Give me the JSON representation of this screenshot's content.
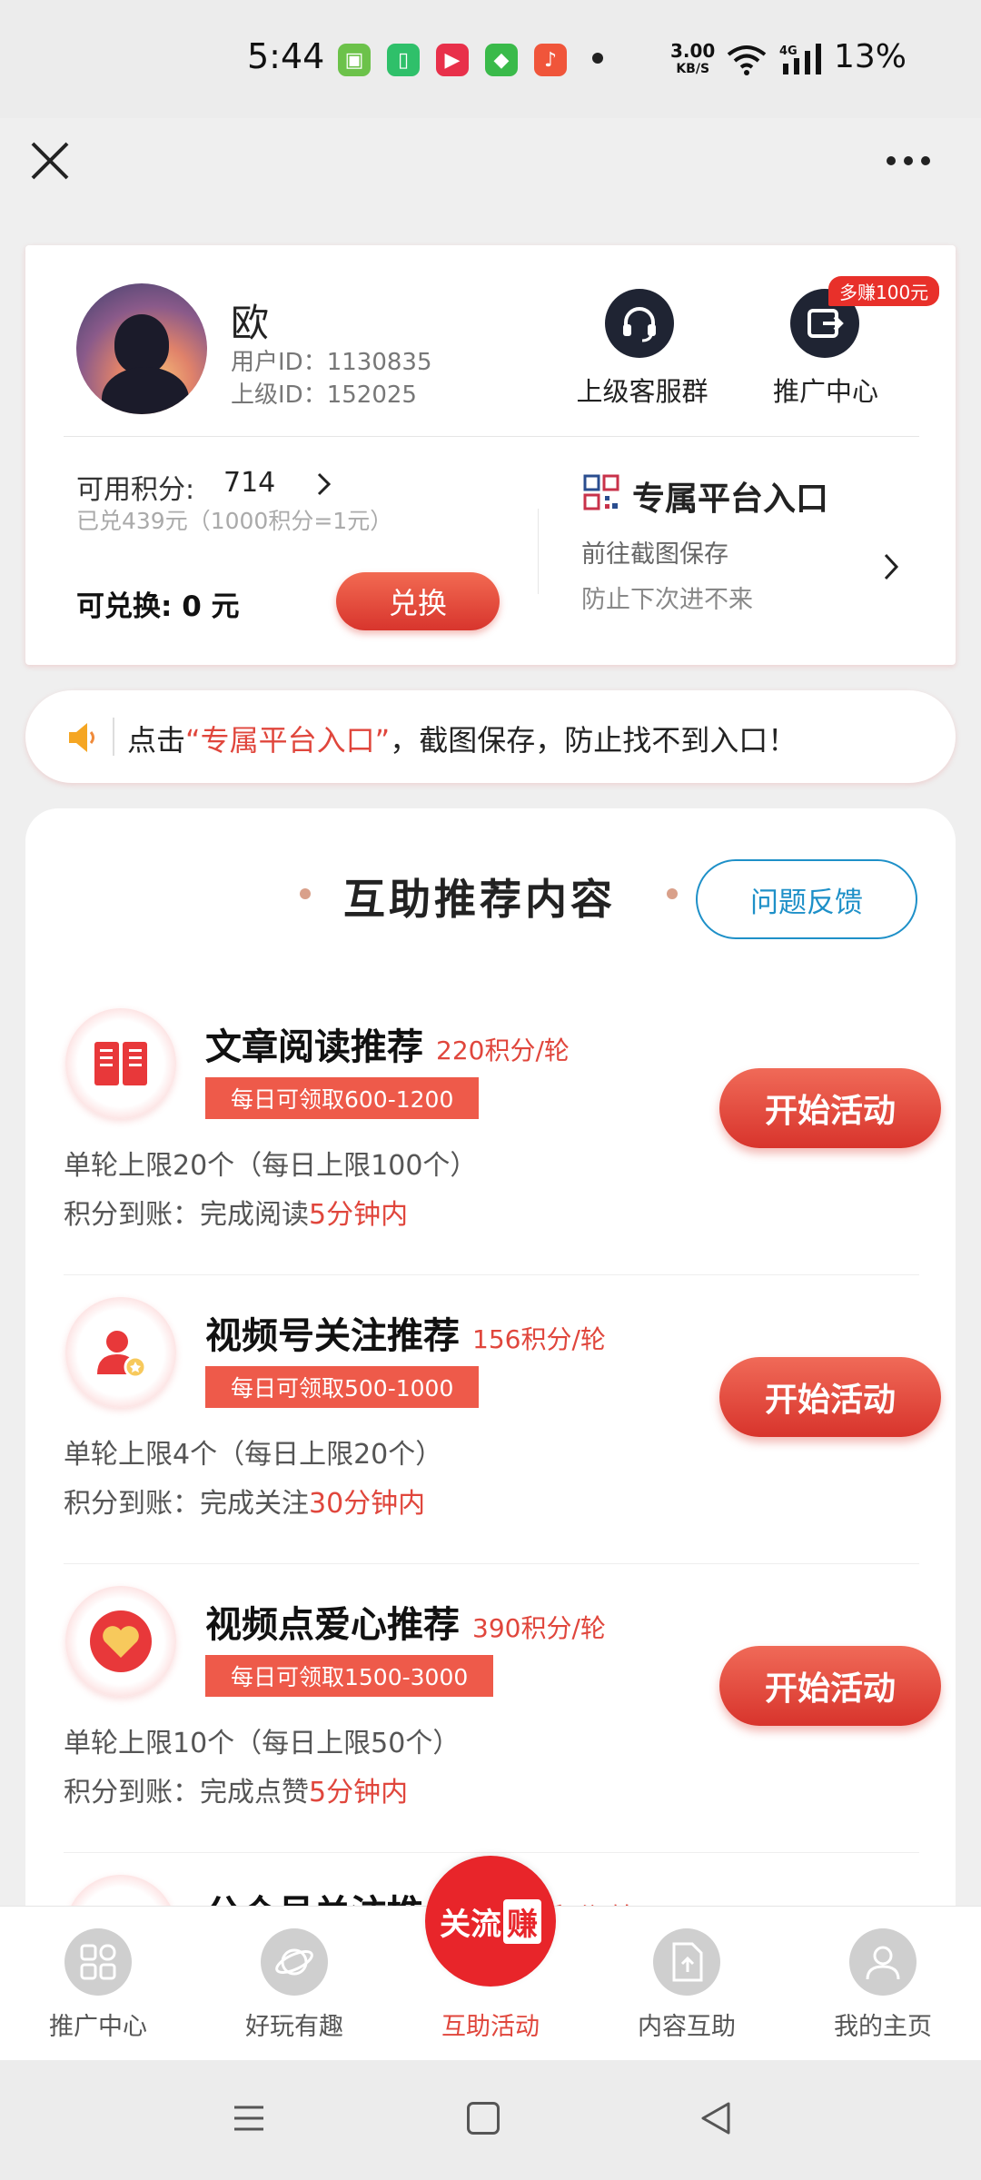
{
  "status_bar": {
    "time": "5:44",
    "net_speed_value": "3.00",
    "net_speed_unit": "KB/S",
    "network": "4G",
    "battery": "13%"
  },
  "profile": {
    "name": "欧",
    "user_id": "用户ID：1130835",
    "parent_id": "上级ID：152025",
    "cs_group_label": "上级客服群",
    "promo_label": "推广中心",
    "earn_badge": "多赚100元"
  },
  "points": {
    "label": "可用积分:",
    "value": "714",
    "redeemed": "已兑439元（1000积分=1元）",
    "exchangeable": "可兑换: 0 元",
    "exchange_button": "兑换"
  },
  "platform": {
    "title": "专属平台入口",
    "sub1": "前往截图保存",
    "sub2": "防止下次进不来"
  },
  "notice": {
    "prefix": "点击",
    "highlight": "“专属平台入口”",
    "suffix": "，截图保存，防止找不到入口！"
  },
  "section": {
    "title": "互助推荐内容",
    "feedback_button": "问题反馈"
  },
  "tasks": [
    {
      "title": "文章阅读推荐",
      "rate": "220积分/轮",
      "badge": "每日可领取600-1200",
      "limit": "单轮上限20个（每日上限100个）",
      "arrive_prefix": "积分到账：完成阅读",
      "arrive_time": "5分钟内",
      "button": "开始活动"
    },
    {
      "title": "视频号关注推荐",
      "rate": "156积分/轮",
      "badge": "每日可领取500-1000",
      "limit": "单轮上限4个（每日上限20个）",
      "arrive_prefix": "积分到账：完成关注",
      "arrive_time": "30分钟内",
      "button": "开始活动"
    },
    {
      "title": "视频点爱心推荐",
      "rate": "390积分/轮",
      "badge": "每日可领取1500-3000",
      "limit": "单轮上限10个（每日上限50个）",
      "arrive_prefix": "积分到账：完成点赞",
      "arrive_time": "5分钟内",
      "button": "开始活动"
    },
    {
      "title": "公众号关注推",
      "rate": "积分/轮"
    }
  ],
  "bottom_nav": {
    "items": [
      "推广中心",
      "好玩有趣",
      "互助活动",
      "内容互助",
      "我的主页"
    ],
    "logo_text": "关流",
    "logo_tag": "赚"
  },
  "colors": {
    "accent": "#e0463c",
    "feedback": "#1e90c8"
  }
}
